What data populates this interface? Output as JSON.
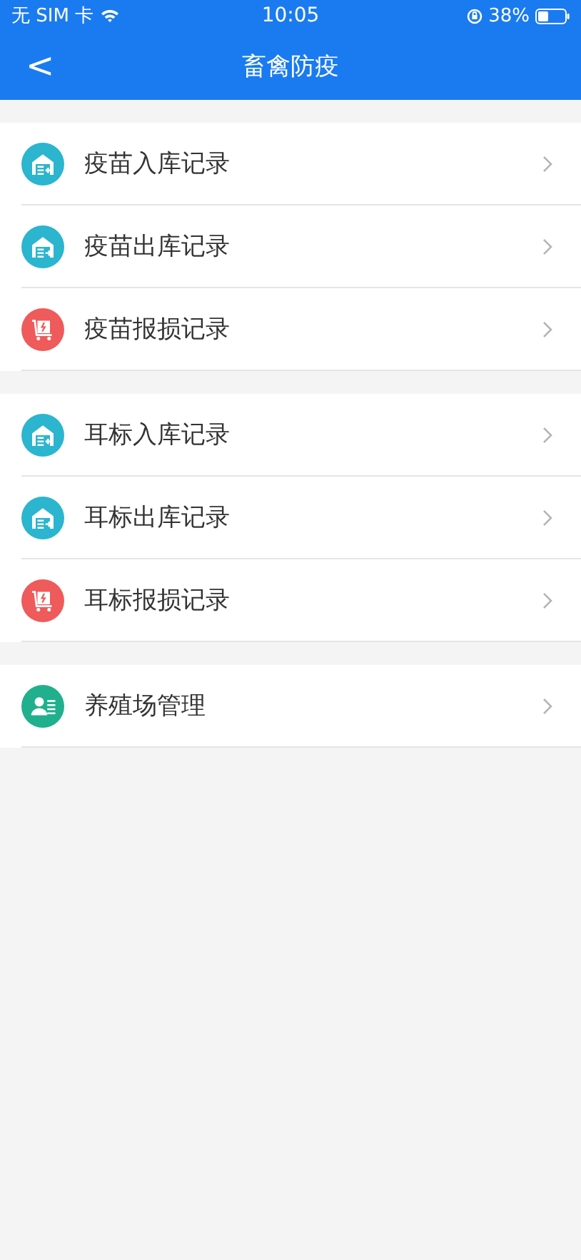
{
  "status_bar": {
    "carrier": "无 SIM 卡",
    "time": "10:05",
    "battery": "38%"
  },
  "nav_bar": {
    "back": "<",
    "title": "畜禽防疫"
  },
  "sections": [
    {
      "items": [
        {
          "kind": "in",
          "label": "疫苗入库记录"
        },
        {
          "kind": "out",
          "label": "疫苗出库记录"
        },
        {
          "kind": "scrap",
          "label": "疫苗报损记录"
        }
      ]
    },
    {
      "items": [
        {
          "kind": "in",
          "label": "耳标入库记录"
        },
        {
          "kind": "out",
          "label": "耳标出库记录"
        },
        {
          "kind": "scrap",
          "label": "耳标报损记录"
        }
      ]
    },
    {
      "items": [
        {
          "kind": "farm",
          "label": "养殖场管理"
        }
      ]
    }
  ]
}
